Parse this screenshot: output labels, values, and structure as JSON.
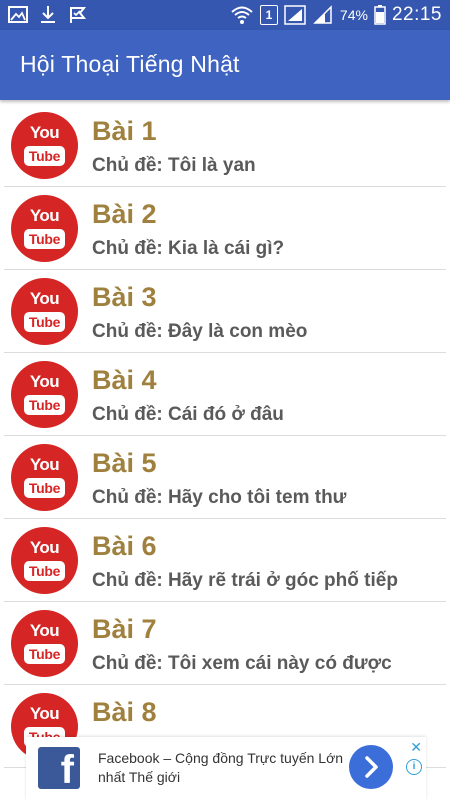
{
  "status_bar": {
    "icons_left": [
      "image-icon",
      "download-icon",
      "check-flag-icon"
    ],
    "sim_slot": "1",
    "battery_percent": "74%",
    "time": "22:15"
  },
  "app_bar": {
    "title": "Hội Thoại Tiếng Nhật"
  },
  "lessons": [
    {
      "title": "Bài 1",
      "topic": "Chủ đề: Tôi là yan"
    },
    {
      "title": "Bài 2",
      "topic": "Chủ đề: Kia là cái gì?"
    },
    {
      "title": "Bài 3",
      "topic": "Chủ đề: Đây là con mèo"
    },
    {
      "title": "Bài 4",
      "topic": "Chủ đề: Cái đó ở đâu"
    },
    {
      "title": "Bài 5",
      "topic": "Chủ đề: Hãy cho tôi tem thư"
    },
    {
      "title": "Bài 6",
      "topic": "Chủ đề: Hãy rẽ trái ở góc phố tiếp"
    },
    {
      "title": "Bài 7",
      "topic": "Chủ đề: Tôi xem cái này có được"
    },
    {
      "title": "Bài 8",
      "topic": ""
    }
  ],
  "thumbnail": {
    "icon": "youtube-icon",
    "you_text": "You",
    "tube_text": "Tube"
  },
  "ad_banner": {
    "logo_letter": "f",
    "text": "Facebook – Cộng đồng Trực tuyến Lớn nhất Thế giới",
    "close_glyph": "✕",
    "info_glyph": "i"
  },
  "colors": {
    "status_bar": "#3557b0",
    "app_bar": "#3f63c1",
    "lesson_title": "#9f803e",
    "youtube_red": "#d62525"
  }
}
